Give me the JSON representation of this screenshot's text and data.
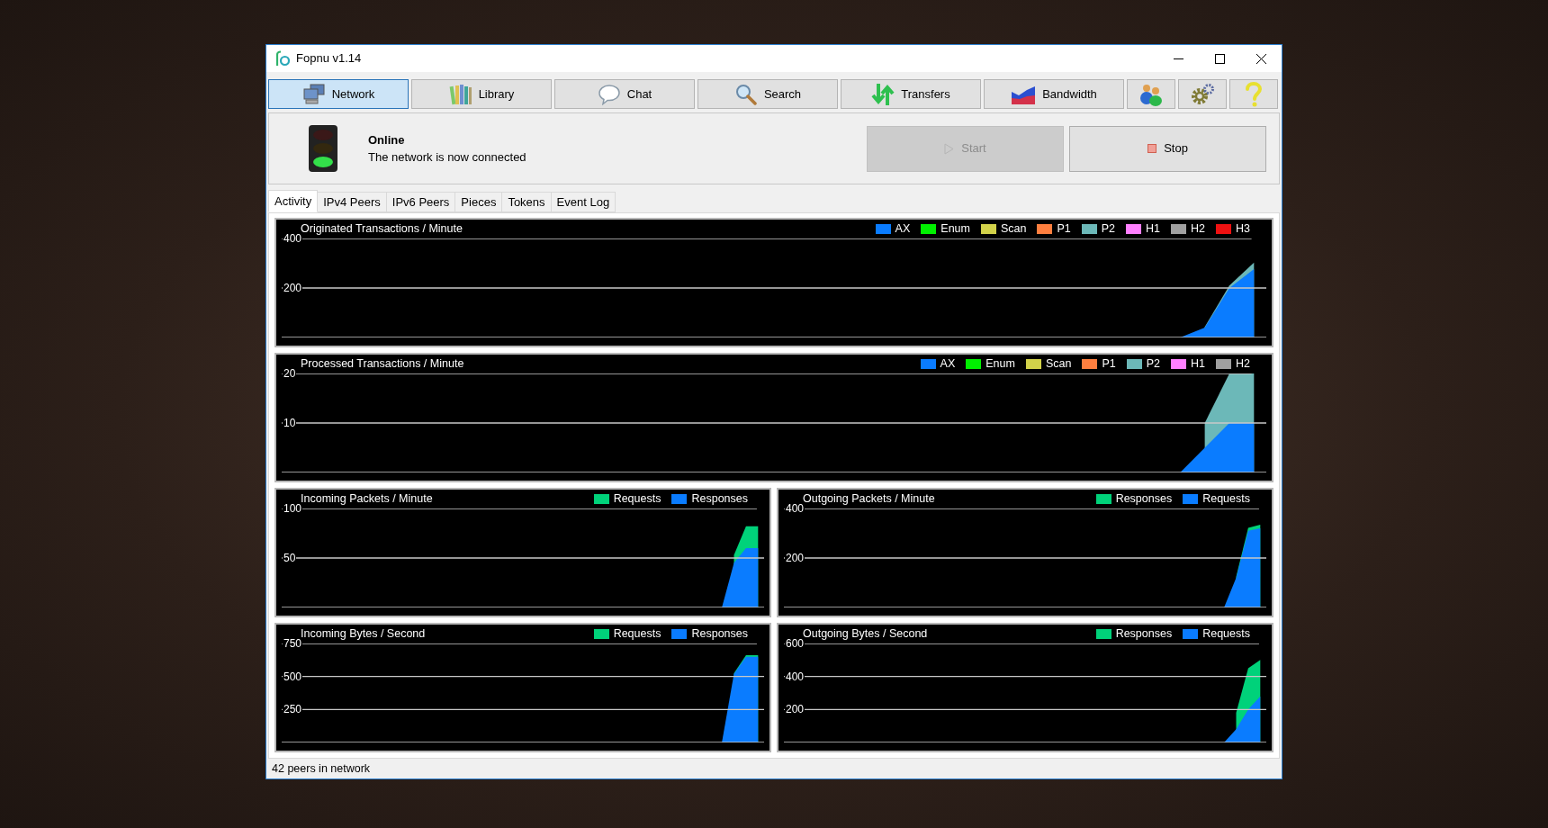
{
  "window": {
    "title": "Fopnu v1.14"
  },
  "toolbar": [
    {
      "kind": "network",
      "label": "Network",
      "selected": true
    },
    {
      "kind": "library",
      "label": "Library",
      "selected": false
    },
    {
      "kind": "chat",
      "label": "Chat",
      "selected": false
    },
    {
      "kind": "search",
      "label": "Search",
      "selected": false
    },
    {
      "kind": "transfers",
      "label": "Transfers",
      "selected": false
    },
    {
      "kind": "bandwidth",
      "label": "Bandwidth",
      "selected": false
    },
    {
      "kind": "users",
      "selected": false
    },
    {
      "kind": "settings",
      "selected": false
    },
    {
      "kind": "help",
      "selected": false
    }
  ],
  "status": {
    "connected": true,
    "title": "Online",
    "message": "The network is now connected"
  },
  "buttons": [
    {
      "kind": "start",
      "label": "Start",
      "disabled": true
    },
    {
      "kind": "stop",
      "label": "Stop",
      "disabled": false
    }
  ],
  "tabs": [
    {
      "label": "Activity",
      "selected": true
    },
    {
      "label": "IPv4 Peers",
      "selected": false
    },
    {
      "label": "IPv6 Peers",
      "selected": false
    },
    {
      "label": "Pieces",
      "selected": false
    },
    {
      "label": "Tokens",
      "selected": false
    },
    {
      "label": "Event Log",
      "selected": false
    }
  ],
  "charts": [
    {
      "chart_data": {
        "type": "area",
        "title": "Originated Transactions / Minute",
        "stacked": false,
        "legend": true,
        "ylim": [
          0,
          400
        ],
        "yticks": [
          200,
          400
        ],
        "series": [
          {
            "name": "AX",
            "color": "#0a7cff",
            "values": [
              null,
              null,
              null,
              null,
              null,
              null,
              null,
              null,
              null,
              null,
              null,
              null,
              null,
              null,
              null,
              null,
              null,
              null,
              null,
              null,
              null,
              null,
              null,
              null,
              null,
              null,
              null,
              null,
              null,
              null,
              null,
              null,
              null,
              null,
              null,
              null,
              0,
              40,
              200,
              276
            ]
          },
          {
            "name": "Enum",
            "color": "#00f000",
            "values": [
              null,
              null,
              null,
              null,
              null,
              null,
              null,
              null,
              null,
              null,
              null,
              null,
              null,
              null,
              null,
              null,
              null,
              null,
              null,
              null,
              null,
              null,
              null,
              null,
              null,
              null,
              null,
              null,
              null,
              null,
              null,
              null,
              null,
              null,
              null,
              null,
              null,
              null,
              null,
              null
            ]
          },
          {
            "name": "Scan",
            "color": "#d2d24a",
            "values": [
              null,
              null,
              null,
              null,
              null,
              null,
              null,
              null,
              null,
              null,
              null,
              null,
              null,
              null,
              null,
              null,
              null,
              null,
              null,
              null,
              null,
              null,
              null,
              null,
              null,
              null,
              null,
              null,
              null,
              null,
              null,
              null,
              null,
              null,
              null,
              null,
              null,
              null,
              null,
              null
            ]
          },
          {
            "name": "P1",
            "color": "#ff7f3f",
            "values": [
              null,
              null,
              null,
              null,
              null,
              null,
              null,
              null,
              null,
              null,
              null,
              null,
              null,
              null,
              null,
              null,
              null,
              null,
              null,
              null,
              null,
              null,
              null,
              null,
              null,
              null,
              null,
              null,
              null,
              null,
              null,
              null,
              null,
              null,
              null,
              null,
              null,
              null,
              null,
              null
            ]
          },
          {
            "name": "P2",
            "color": "#6cb8b8",
            "values": [
              null,
              null,
              null,
              null,
              null,
              null,
              null,
              null,
              null,
              null,
              null,
              null,
              null,
              null,
              null,
              null,
              null,
              null,
              null,
              null,
              null,
              null,
              null,
              null,
              null,
              null,
              null,
              null,
              null,
              null,
              null,
              null,
              null,
              null,
              null,
              null,
              null,
              43,
              210,
              303
            ]
          },
          {
            "name": "H1",
            "color": "#ff80ff",
            "values": [
              null,
              null,
              null,
              null,
              null,
              null,
              null,
              null,
              null,
              null,
              null,
              null,
              null,
              null,
              null,
              null,
              null,
              null,
              null,
              null,
              null,
              null,
              null,
              null,
              null,
              null,
              null,
              null,
              null,
              null,
              null,
              null,
              null,
              null,
              null,
              null,
              null,
              null,
              null,
              null
            ]
          },
          {
            "name": "H2",
            "color": "#a0a0a0",
            "values": [
              null,
              null,
              null,
              null,
              null,
              null,
              null,
              null,
              null,
              null,
              null,
              null,
              null,
              null,
              null,
              null,
              null,
              null,
              null,
              null,
              null,
              null,
              null,
              null,
              null,
              null,
              null,
              null,
              null,
              null,
              null,
              null,
              null,
              null,
              null,
              null,
              null,
              null,
              null,
              null
            ]
          },
          {
            "name": "H3",
            "color": "#ee1111",
            "values": [
              null,
              null,
              null,
              null,
              null,
              null,
              null,
              null,
              null,
              null,
              null,
              null,
              null,
              null,
              null,
              null,
              null,
              null,
              null,
              null,
              null,
              null,
              null,
              null,
              null,
              null,
              null,
              null,
              null,
              null,
              null,
              null,
              null,
              null,
              null,
              null,
              null,
              null,
              null,
              null
            ]
          }
        ]
      }
    },
    {
      "chart_data": {
        "type": "area",
        "title": "Processed Transactions / Minute",
        "stacked": false,
        "legend": true,
        "ylim": [
          0,
          20
        ],
        "yticks": [
          10,
          20
        ],
        "series": [
          {
            "name": "AX",
            "color": "#0a7cff",
            "values": [
              null,
              null,
              null,
              null,
              null,
              null,
              null,
              null,
              null,
              null,
              null,
              null,
              null,
              null,
              null,
              null,
              null,
              null,
              null,
              null,
              null,
              null,
              null,
              null,
              null,
              null,
              null,
              null,
              null,
              null,
              null,
              null,
              null,
              null,
              null,
              null,
              0,
              5,
              10,
              10
            ]
          },
          {
            "name": "Enum",
            "color": "#00f000",
            "values": [
              null,
              null,
              null,
              null,
              null,
              null,
              null,
              null,
              null,
              null,
              null,
              null,
              null,
              null,
              null,
              null,
              null,
              null,
              null,
              null,
              null,
              null,
              null,
              null,
              null,
              null,
              null,
              null,
              null,
              null,
              null,
              null,
              null,
              null,
              null,
              null,
              null,
              null,
              null,
              null
            ]
          },
          {
            "name": "Scan",
            "color": "#d2d24a",
            "values": [
              null,
              null,
              null,
              null,
              null,
              null,
              null,
              null,
              null,
              null,
              null,
              null,
              null,
              null,
              null,
              null,
              null,
              null,
              null,
              null,
              null,
              null,
              null,
              null,
              null,
              null,
              null,
              null,
              null,
              null,
              null,
              null,
              null,
              null,
              null,
              null,
              null,
              null,
              null,
              null
            ]
          },
          {
            "name": "P1",
            "color": "#ff7f3f",
            "values": [
              null,
              null,
              null,
              null,
              null,
              null,
              null,
              null,
              null,
              null,
              null,
              null,
              null,
              null,
              null,
              null,
              null,
              null,
              null,
              null,
              null,
              null,
              null,
              null,
              null,
              null,
              null,
              null,
              null,
              null,
              null,
              null,
              null,
              null,
              null,
              null,
              null,
              null,
              null,
              null
            ]
          },
          {
            "name": "P2",
            "color": "#6cb8b8",
            "values": [
              null,
              null,
              null,
              null,
              null,
              null,
              null,
              null,
              null,
              null,
              null,
              null,
              null,
              null,
              null,
              null,
              null,
              null,
              null,
              null,
              null,
              null,
              null,
              null,
              null,
              null,
              null,
              null,
              null,
              null,
              null,
              null,
              null,
              null,
              null,
              null,
              null,
              10,
              20,
              20
            ]
          },
          {
            "name": "H1",
            "color": "#ff80ff",
            "values": [
              null,
              null,
              null,
              null,
              null,
              null,
              null,
              null,
              null,
              null,
              null,
              null,
              null,
              null,
              null,
              null,
              null,
              null,
              null,
              null,
              null,
              null,
              null,
              null,
              null,
              null,
              null,
              null,
              null,
              null,
              null,
              null,
              null,
              null,
              null,
              null,
              null,
              null,
              null,
              null
            ]
          },
          {
            "name": "H2",
            "color": "#a0a0a0",
            "values": [
              null,
              null,
              null,
              null,
              null,
              null,
              null,
              null,
              null,
              null,
              null,
              null,
              null,
              null,
              null,
              null,
              null,
              null,
              null,
              null,
              null,
              null,
              null,
              null,
              null,
              null,
              null,
              null,
              null,
              null,
              null,
              null,
              null,
              null,
              null,
              null,
              null,
              null,
              null,
              null
            ]
          }
        ]
      }
    },
    {
      "chart_data": {
        "type": "area",
        "title": "Incoming Packets / Minute",
        "stacked": false,
        "legend": true,
        "ylim": [
          0,
          100
        ],
        "yticks": [
          50,
          100
        ],
        "series": [
          {
            "name": "Requests",
            "color": "#00d27a",
            "values": [
              null,
              null,
              null,
              null,
              null,
              null,
              null,
              null,
              null,
              null,
              null,
              null,
              null,
              null,
              null,
              null,
              null,
              null,
              null,
              null,
              null,
              null,
              null,
              null,
              null,
              null,
              null,
              null,
              null,
              null,
              null,
              null,
              null,
              null,
              null,
              null,
              null,
              53,
              82,
              82
            ]
          },
          {
            "name": "Responses",
            "color": "#0a7cff",
            "values": [
              null,
              null,
              null,
              null,
              null,
              null,
              null,
              null,
              null,
              null,
              null,
              null,
              null,
              null,
              null,
              null,
              null,
              null,
              null,
              null,
              null,
              null,
              null,
              null,
              null,
              null,
              null,
              null,
              null,
              null,
              null,
              null,
              null,
              null,
              null,
              null,
              0,
              45,
              60,
              60
            ]
          }
        ]
      }
    },
    {
      "chart_data": {
        "type": "area",
        "title": "Outgoing Packets / Minute",
        "stacked": false,
        "legend": true,
        "ylim": [
          0,
          400
        ],
        "yticks": [
          200,
          400
        ],
        "series": [
          {
            "name": "Responses",
            "color": "#00d27a",
            "values": [
              null,
              null,
              null,
              null,
              null,
              null,
              null,
              null,
              null,
              null,
              null,
              null,
              null,
              null,
              null,
              null,
              null,
              null,
              null,
              null,
              null,
              null,
              null,
              null,
              null,
              null,
              null,
              null,
              null,
              null,
              null,
              null,
              null,
              null,
              null,
              null,
              null,
              125,
              322,
              335
            ]
          },
          {
            "name": "Requests",
            "color": "#0a7cff",
            "values": [
              null,
              null,
              null,
              null,
              null,
              null,
              null,
              null,
              null,
              null,
              null,
              null,
              null,
              null,
              null,
              null,
              null,
              null,
              null,
              null,
              null,
              null,
              null,
              null,
              null,
              null,
              null,
              null,
              null,
              null,
              null,
              null,
              null,
              null,
              null,
              null,
              0,
              120,
              310,
              320
            ]
          }
        ]
      }
    },
    {
      "chart_data": {
        "type": "area",
        "title": "Incoming Bytes / Second",
        "stacked": false,
        "legend": true,
        "ylim": [
          0,
          750
        ],
        "yticks": [
          250,
          500,
          750
        ],
        "series": [
          {
            "name": "Requests",
            "color": "#00d27a",
            "values": [
              null,
              null,
              null,
              null,
              null,
              null,
              null,
              null,
              null,
              null,
              null,
              null,
              null,
              null,
              null,
              null,
              null,
              null,
              null,
              null,
              null,
              null,
              null,
              null,
              null,
              null,
              null,
              null,
              null,
              null,
              null,
              null,
              null,
              null,
              null,
              null,
              null,
              525,
              662,
              662
            ]
          },
          {
            "name": "Responses",
            "color": "#0a7cff",
            "values": [
              null,
              null,
              null,
              null,
              null,
              null,
              null,
              null,
              null,
              null,
              null,
              null,
              null,
              null,
              null,
              null,
              null,
              null,
              null,
              null,
              null,
              null,
              null,
              null,
              null,
              null,
              null,
              null,
              null,
              null,
              null,
              null,
              null,
              null,
              null,
              null,
              0,
              520,
              650,
              650
            ]
          }
        ]
      }
    },
    {
      "chart_data": {
        "type": "area",
        "title": "Outgoing Bytes / Second",
        "stacked": false,
        "legend": true,
        "ylim": [
          0,
          600
        ],
        "yticks": [
          200,
          400,
          600
        ],
        "series": [
          {
            "name": "Responses",
            "color": "#00d27a",
            "values": [
              null,
              null,
              null,
              null,
              null,
              null,
              null,
              null,
              null,
              null,
              null,
              null,
              null,
              null,
              null,
              null,
              null,
              null,
              null,
              null,
              null,
              null,
              null,
              null,
              null,
              null,
              null,
              null,
              null,
              null,
              null,
              null,
              null,
              null,
              null,
              null,
              null,
              180,
              450,
              500
            ]
          },
          {
            "name": "Requests",
            "color": "#0a7cff",
            "values": [
              null,
              null,
              null,
              null,
              null,
              null,
              null,
              null,
              null,
              null,
              null,
              null,
              null,
              null,
              null,
              null,
              null,
              null,
              null,
              null,
              null,
              null,
              null,
              null,
              null,
              null,
              null,
              null,
              null,
              null,
              null,
              null,
              null,
              null,
              null,
              null,
              0,
              80,
              200,
              280
            ]
          }
        ]
      }
    }
  ],
  "status_bar": "42 peers in network"
}
